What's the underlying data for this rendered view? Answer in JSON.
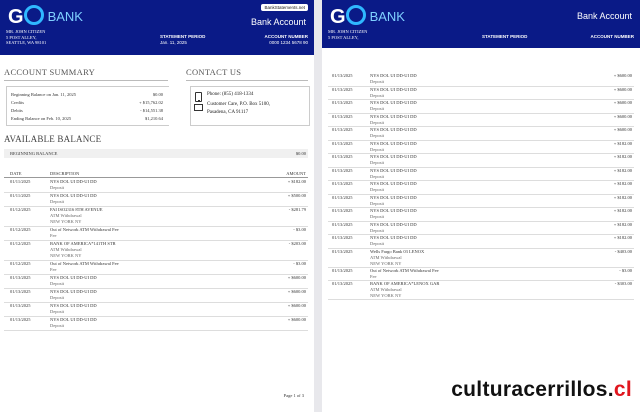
{
  "brand": {
    "logo_text": "G2",
    "logo_suffix": "BANK",
    "site_badge": "BankStatements.net",
    "doc_title": "Bank Account"
  },
  "customer": {
    "name": "MR. JOHN CITIZEN",
    "street": "5 POST ALLEY,",
    "city": "SEATTLE, WA 98101"
  },
  "statement": {
    "label": "STATEMENT PERIOD",
    "value": "Jan. 11, 2025"
  },
  "account": {
    "label": "ACCOUNT NUMBER",
    "value": "0000 1234 5678 90"
  },
  "summary": {
    "heading": "ACCOUNT SUMMARY",
    "rows": [
      {
        "label": "Beginning Balance on Jan. 11, 2025",
        "value": "$0.00"
      },
      {
        "label": "Credits",
        "value": "+ $15,762.02"
      },
      {
        "label": "Debits",
        "value": "- $14,551.38"
      },
      {
        "label": "Ending Balance on Feb. 10, 2025",
        "value": "$1,210.64"
      }
    ]
  },
  "contact": {
    "heading": "CONTACT US",
    "phone": "Phone: (855) 418-1334",
    "care": "Customer Care, P.O. Box 5100,",
    "city": "Pasadena, CA 91117"
  },
  "available": {
    "heading": "AVAILABLE BALANCE",
    "beginning_label": "BEGINNING BALANCE",
    "beginning_value": "$0.00",
    "columns": {
      "date": "DATE",
      "description": "DESCRIPTION",
      "amount": "AMOUNT"
    }
  },
  "transactions_p1": [
    {
      "date": "01/11/2025",
      "desc": "NYS DOL UI DD-UI DD",
      "sub": "Deposit",
      "sub2": "",
      "amount": "+ $182.00"
    },
    {
      "date": "01/11/2025",
      "desc": "NYS DOL UI DD-UI DD",
      "sub": "Deposit",
      "sub2": "",
      "amount": "+ $500.00"
    },
    {
      "date": "01/12/2025",
      "desc": "FAI ISO2316 8TH AVENUE",
      "sub": "ATM Withdrawal",
      "sub2": "NEW YORK NY",
      "amount": "- $281.79"
    },
    {
      "date": "01/12/2025",
      "desc": "Out of Network ATM Withdrawal Fee",
      "sub": "Fee",
      "sub2": "",
      "amount": "- $3.00"
    },
    {
      "date": "01/12/2025",
      "desc": "BANK OF AMERICA*141TH STR",
      "sub": "ATM Withdrawal",
      "sub2": "NEW YORK NY",
      "amount": "- $203.00"
    },
    {
      "date": "01/12/2025",
      "desc": "Out of Network ATM Withdrawal Fee",
      "sub": "Fee",
      "sub2": "",
      "amount": "- $3.00"
    },
    {
      "date": "01/13/2025",
      "desc": "NYS DOL UI DD-UI DD",
      "sub": "Deposit",
      "sub2": "",
      "amount": "+ $600.00"
    },
    {
      "date": "01/13/2025",
      "desc": "NYS DOL UI DD-UI DD",
      "sub": "Deposit",
      "sub2": "",
      "amount": "+ $600.00"
    },
    {
      "date": "01/13/2025",
      "desc": "NYS DOL UI DD-UI DD",
      "sub": "Deposit",
      "sub2": "",
      "amount": "+ $600.00"
    },
    {
      "date": "01/13/2025",
      "desc": "NYS DOL UI DD-UI DD",
      "sub": "Deposit",
      "sub2": "",
      "amount": "+ $600.00"
    }
  ],
  "page_number": "Page 1 of 3",
  "transactions_p2": [
    {
      "date": "01/13/2025",
      "desc": "NYS DOL UI DD-UI DD",
      "sub": "Deposit",
      "sub2": "",
      "amount": "+ $600.00"
    },
    {
      "date": "01/13/2025",
      "desc": "NYS DOL UI DD-UI DD",
      "sub": "Deposit",
      "sub2": "",
      "amount": "+ $600.00"
    },
    {
      "date": "01/13/2025",
      "desc": "NYS DOL UI DD-UI DD",
      "sub": "Deposit",
      "sub2": "",
      "amount": "+ $600.00"
    },
    {
      "date": "01/13/2025",
      "desc": "NYS DOL UI DD-UI DD",
      "sub": "Deposit",
      "sub2": "",
      "amount": "+ $600.00"
    },
    {
      "date": "01/13/2025",
      "desc": "NYS DOL UI DD-UI DD",
      "sub": "Deposit",
      "sub2": "",
      "amount": "+ $600.00"
    },
    {
      "date": "01/13/2025",
      "desc": "NYS DOL UI DD-UI DD",
      "sub": "Deposit",
      "sub2": "",
      "amount": "+ $182.00"
    },
    {
      "date": "01/13/2025",
      "desc": "NYS DOL UI DD-UI DD",
      "sub": "Deposit",
      "sub2": "",
      "amount": "+ $182.00"
    },
    {
      "date": "01/13/2025",
      "desc": "NYS DOL UI DD-UI DD",
      "sub": "Deposit",
      "sub2": "",
      "amount": "+ $182.00"
    },
    {
      "date": "01/13/2025",
      "desc": "NYS DOL UI DD-UI DD",
      "sub": "Deposit",
      "sub2": "",
      "amount": "+ $182.00"
    },
    {
      "date": "01/13/2025",
      "desc": "NYS DOL UI DD-UI DD",
      "sub": "Deposit",
      "sub2": "",
      "amount": "+ $182.00"
    },
    {
      "date": "01/13/2025",
      "desc": "NYS DOL UI DD-UI DD",
      "sub": "Deposit",
      "sub2": "",
      "amount": "+ $182.00"
    },
    {
      "date": "01/13/2025",
      "desc": "NYS DOL UI DD-UI DD",
      "sub": "Deposit",
      "sub2": "",
      "amount": "+ $182.00"
    },
    {
      "date": "01/13/2025",
      "desc": "NYS DOL UI DD-UI DD",
      "sub": "Deposit",
      "sub2": "",
      "amount": "+ $182.00"
    },
    {
      "date": "01/13/2025",
      "desc": "Wells Fargo Bank 03 LENOX",
      "sub": "ATM Withdrawal",
      "sub2": "NEW YORK NY",
      "amount": "- $403.00"
    },
    {
      "date": "01/13/2025",
      "desc": "Out of Network ATM Withdrawal Fee",
      "sub": "Fee",
      "sub2": "",
      "amount": "- $3.00"
    },
    {
      "date": "01/13/2025",
      "desc": "BANK OF AMERICA*LENOX GAR",
      "sub": "ATM Withdrawal",
      "sub2": "NEW YORK NY",
      "amount": "- $303.00"
    }
  ],
  "watermark": {
    "main": "culturacerrillos.",
    "tld": "cl"
  },
  "colors": {
    "header_bg": "#0a1a87",
    "logo_ring": "#2fb8ff",
    "watermark_accent": "#e0161e"
  }
}
